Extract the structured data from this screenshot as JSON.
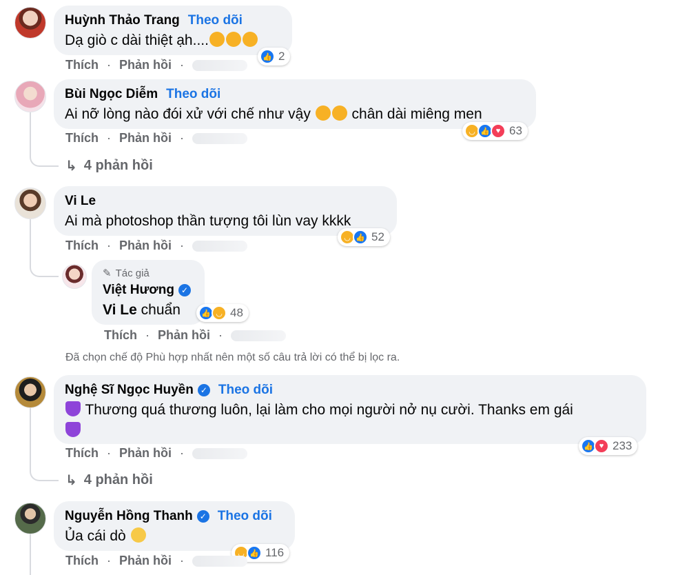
{
  "comments": [
    {
      "name": "Huỳnh Thảo Trang",
      "follow": "Theo dõi",
      "text": "Dạ giò c dài thiệt ạh....",
      "reaction_count": "2",
      "actions": {
        "like": "Thích",
        "reply": "Phản hồi",
        "sep": "·"
      }
    },
    {
      "name": "Bùi Ngọc Diễm",
      "follow": "Theo dõi",
      "text_before": "Ai nỡ lòng nào đói xử với chế như vậy",
      "text_after": "chân dài miêng men",
      "reaction_count": "63",
      "actions": {
        "like": "Thích",
        "reply": "Phản hồi",
        "sep": "·"
      },
      "replies_label": "4 phản hồi"
    },
    {
      "name": "Vi Le",
      "text": "Ai mà photoshop thần tượng tôi lùn vay kkkk",
      "reaction_count": "52",
      "actions": {
        "like": "Thích",
        "reply": "Phản hồi",
        "sep": "·"
      }
    },
    {
      "name": "Việt Hương",
      "author_badge": "Tác giả",
      "text_bold": "Vi Le",
      "text": "chuẩn",
      "reaction_count": "48",
      "actions": {
        "like": "Thích",
        "reply": "Phản hồi",
        "sep": "·"
      }
    },
    {
      "name": "Nghệ Sĩ Ngọc Huyền",
      "follow": "Theo dõi",
      "text": "Thương quá thương luôn, lại làm cho mọi người nở nụ cười. Thanks em gái",
      "reaction_count": "233",
      "actions": {
        "like": "Thích",
        "reply": "Phản hồi",
        "sep": "·"
      },
      "replies_label": "4 phản hồi"
    },
    {
      "name": "Nguyễn Hồng Thanh",
      "follow": "Theo dõi",
      "text": "Ủa cái dò",
      "reaction_count": "116",
      "actions": {
        "like": "Thích",
        "reply": "Phản hồi",
        "sep": "·"
      }
    }
  ],
  "filter_notice": "Đã chọn chế độ Phù hợp nhất nên một số câu trả lời có thể bị lọc ra.",
  "colors": {
    "link": "#1b74e4",
    "bubble": "#f0f2f5",
    "muted": "#65676b",
    "like": "#1877f2",
    "love": "#f33e58",
    "haha": "#f7b125"
  }
}
